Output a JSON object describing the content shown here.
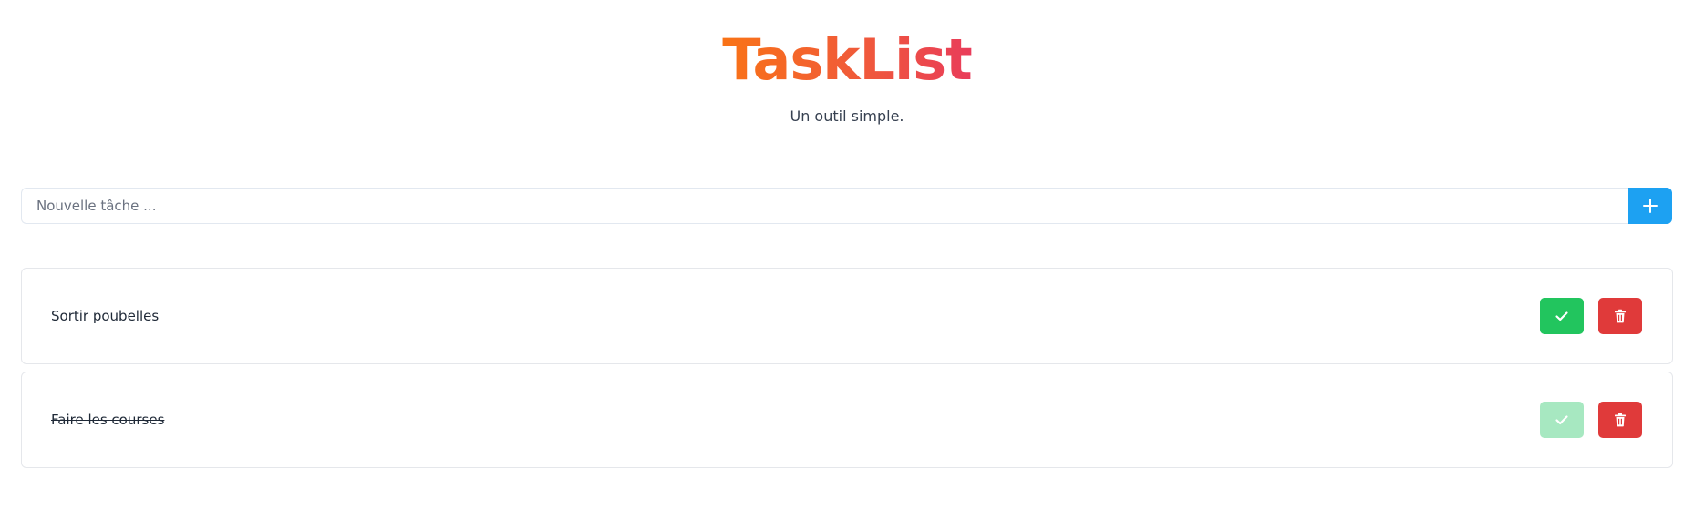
{
  "header": {
    "title": "TaskList",
    "subtitle": "Un outil simple."
  },
  "add_form": {
    "input_value": "",
    "input_placeholder": "Nouvelle tâche ...",
    "add_button_icon": "plus-icon"
  },
  "tasks": [
    {
      "label": "Sortir poubelles",
      "completed": false,
      "complete_button_icon": "check-icon",
      "delete_button_icon": "trash-icon"
    },
    {
      "label": "Faire les courses",
      "completed": true,
      "complete_button_icon": "check-icon",
      "delete_button_icon": "trash-icon"
    }
  ],
  "colors": {
    "accent": "#1da1f2",
    "complete": "#22c55e",
    "complete_disabled": "#a7e8c1",
    "delete": "#e03a3a",
    "title_gradient_start": "#f97316",
    "title_gradient_end": "#e93c5a"
  }
}
